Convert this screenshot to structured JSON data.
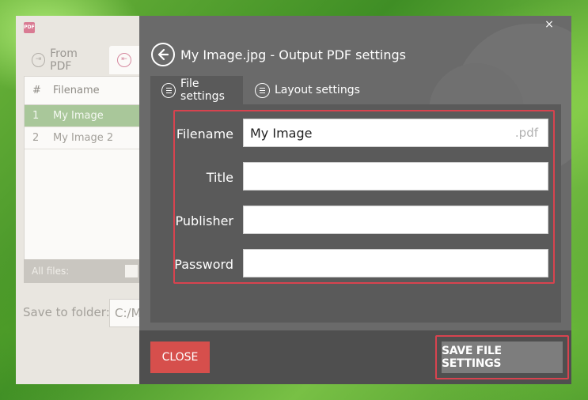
{
  "background_app": {
    "logo_text": "PDF",
    "tabs": [
      {
        "label": "From PDF",
        "icon": "from-pdf-icon"
      },
      {
        "label": "",
        "icon": "to-pdf-icon"
      }
    ],
    "table": {
      "headers": [
        "#",
        "Filename"
      ],
      "rows": [
        {
          "num": "1",
          "name": "My Image"
        },
        {
          "num": "2",
          "name": "My Image 2"
        }
      ]
    },
    "footer_label": "All files:",
    "save_label": "Save to folder:",
    "save_path": "C:/M"
  },
  "modal": {
    "close_glyph": "×",
    "title": "My Image.jpg - Output PDF settings",
    "tabs": [
      {
        "label": "File settings",
        "icon": "file-icon",
        "active": true
      },
      {
        "label": "Layout settings",
        "icon": "layout-icon",
        "active": false
      }
    ],
    "form": {
      "filename": {
        "label": "Filename",
        "value": "My Image",
        "suffix": ".pdf"
      },
      "title": {
        "label": "Title",
        "value": ""
      },
      "publisher": {
        "label": "Publisher",
        "value": ""
      },
      "password": {
        "label": "Password",
        "value": ""
      }
    },
    "buttons": {
      "close": "CLOSE",
      "save": "SAVE FILE SETTINGS"
    }
  },
  "colors": {
    "accent_red": "#d64f4c",
    "highlight_outline": "#d8434f",
    "modal_bg": "#6a6a6a",
    "selected_row": "#a9c79a"
  }
}
